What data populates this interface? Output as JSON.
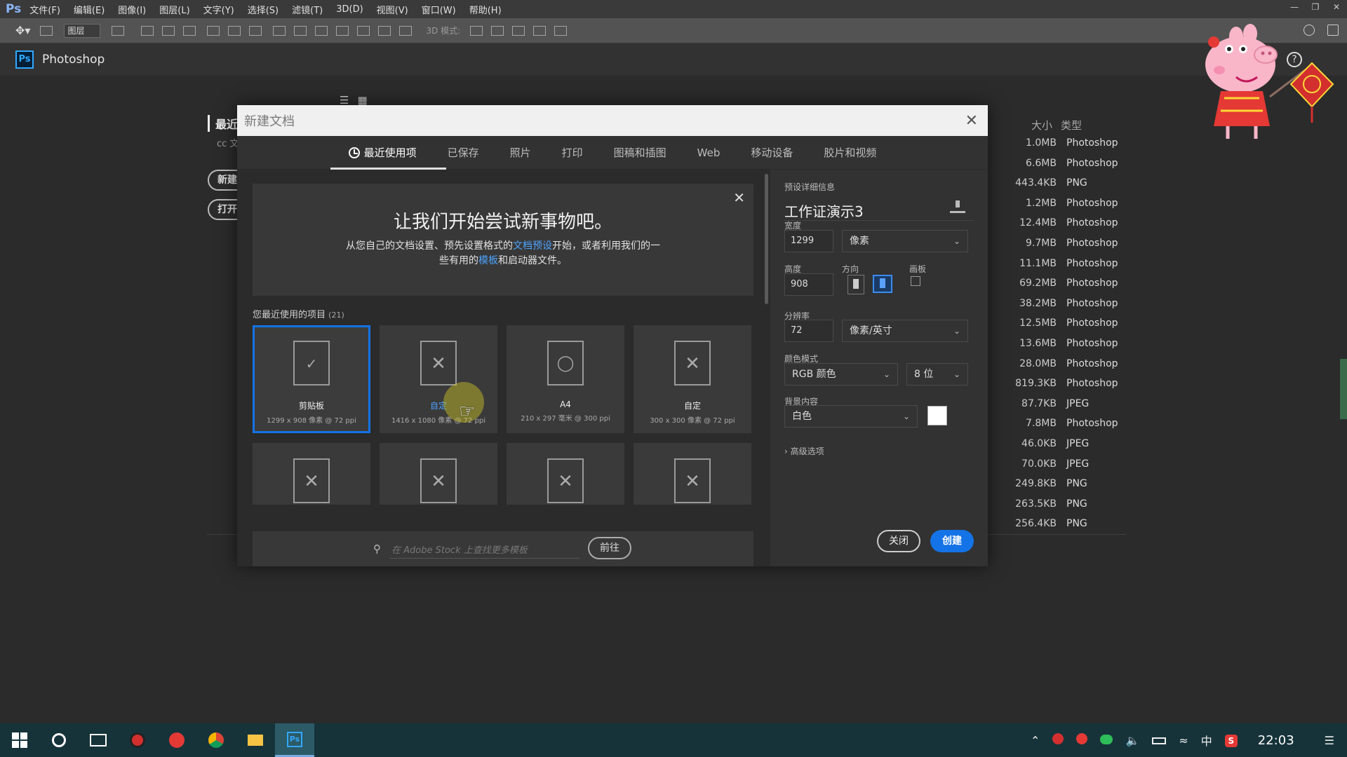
{
  "menubar": {
    "logo": "Ps",
    "items": [
      "文件(F)",
      "编辑(E)",
      "图像(I)",
      "图层(L)",
      "文字(Y)",
      "选择(S)",
      "滤镜(T)",
      "3D(D)",
      "视图(V)",
      "窗口(W)",
      "帮助(H)"
    ]
  },
  "optbar": {
    "layer_select": "图层",
    "mode3d": "3D 模式:"
  },
  "app": {
    "title": "Photoshop",
    "ps_icon": "Ps",
    "help": "?"
  },
  "workspace": {
    "recent_label": "最近",
    "cc_label": "cc 文",
    "new_button": "新建",
    "open_button": "打开",
    "col_size": "大小",
    "col_type": "类型",
    "files": [
      {
        "size": "1.0MB",
        "type": "Photoshop"
      },
      {
        "size": "6.6MB",
        "type": "Photoshop"
      },
      {
        "size": "443.4KB",
        "type": "PNG"
      },
      {
        "size": "1.2MB",
        "type": "Photoshop"
      },
      {
        "size": "12.4MB",
        "type": "Photoshop"
      },
      {
        "size": "9.7MB",
        "type": "Photoshop"
      },
      {
        "size": "11.1MB",
        "type": "Photoshop"
      },
      {
        "size": "69.2MB",
        "type": "Photoshop"
      },
      {
        "size": "38.2MB",
        "type": "Photoshop"
      },
      {
        "size": "12.5MB",
        "type": "Photoshop"
      },
      {
        "size": "13.6MB",
        "type": "Photoshop"
      },
      {
        "size": "28.0MB",
        "type": "Photoshop"
      },
      {
        "size": "819.3KB",
        "type": "Photoshop"
      },
      {
        "size": "87.7KB",
        "type": "JPEG"
      },
      {
        "size": "7.8MB",
        "type": "Photoshop"
      },
      {
        "size": "46.0KB",
        "type": "JPEG"
      },
      {
        "size": "70.0KB",
        "type": "JPEG"
      },
      {
        "size": "249.8KB",
        "type": "PNG"
      },
      {
        "size": "263.5KB",
        "type": "PNG"
      },
      {
        "size": "256.4KB",
        "type": "PNG"
      }
    ]
  },
  "dialog": {
    "title": "新建文档",
    "tabs": [
      "最近使用项",
      "已保存",
      "照片",
      "打印",
      "图稿和插图",
      "Web",
      "移动设备",
      "胶片和视频"
    ],
    "active_tab": 0,
    "promo": {
      "heading": "让我们开始尝试新事物吧。",
      "line1_a": "从您自己的文档设置、预先设置格式的",
      "line1_link": "文档预设",
      "line1_b": "开始，或者利用我们的一",
      "line2_a": "些有用的",
      "line2_link": "模板",
      "line2_b": "和启动器文件。"
    },
    "recent_title": "您最近使用的项目",
    "recent_count": "(21)",
    "cards": [
      {
        "name": "剪贴板",
        "dim": "1299 x 908 像素 @ 72 ppi",
        "icon": "clipboard-check",
        "selected": true
      },
      {
        "name": "自定",
        "dim": "1416 x 1080 像素 @ 72 ppi",
        "icon": "custom-pencil",
        "selected": false,
        "hover": true
      },
      {
        "name": "A4",
        "dim": "210 x 297 毫米 @ 300 ppi",
        "icon": "shapes",
        "selected": false
      },
      {
        "name": "自定",
        "dim": "300 x 300 像素 @ 72 ppi",
        "icon": "custom-pencil",
        "selected": false
      }
    ],
    "stock": {
      "placeholder": "在 Adobe Stock 上查找更多模板",
      "go": "前往"
    },
    "preset": {
      "section_label": "预设详细信息",
      "name": "工作证演示3",
      "width_label": "宽度",
      "width": "1299",
      "width_unit": "像素",
      "height_label": "高度",
      "height": "908",
      "orientation_label": "方向",
      "artboard_label": "画板",
      "resolution_label": "分辨率",
      "resolution": "72",
      "resolution_unit": "像素/英寸",
      "color_mode_label": "颜色模式",
      "color_mode": "RGB 颜色",
      "bit_depth": "8 位",
      "bg_label": "背景内容",
      "bg_value": "白色",
      "advanced": "高级选项"
    },
    "buttons": {
      "close": "关闭",
      "create": "创建"
    }
  },
  "taskbar": {
    "ime": "中",
    "clock": "22:03"
  }
}
